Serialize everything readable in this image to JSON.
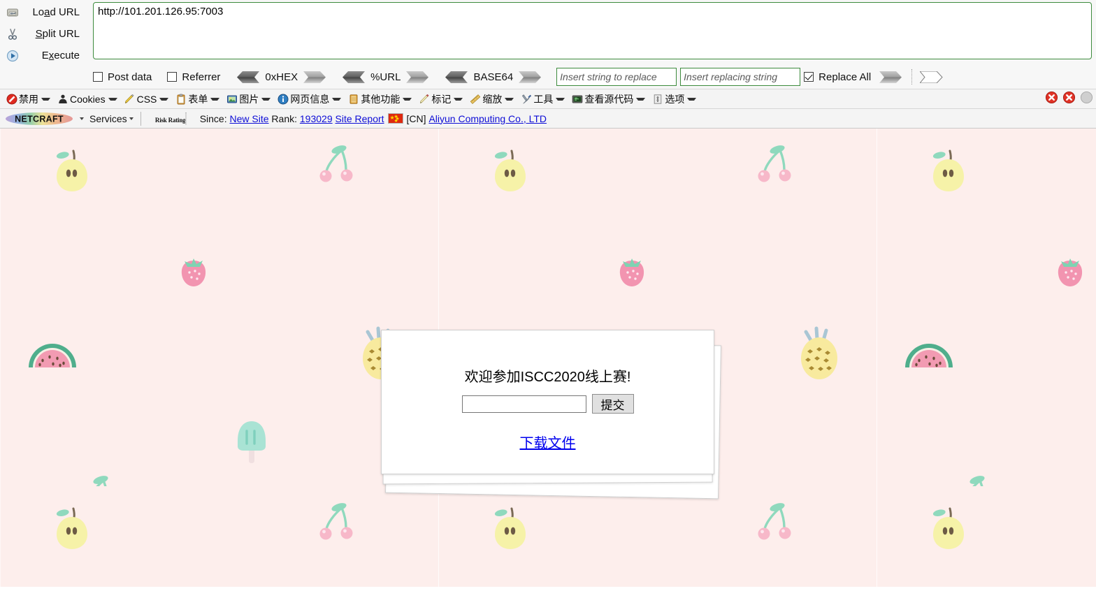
{
  "hackbar": {
    "actions": [
      {
        "icon": "load-url-icon",
        "label": "Load URL",
        "accesskey": "a"
      },
      {
        "icon": "split-url-icon",
        "label": "Split URL",
        "accesskey": "S"
      },
      {
        "icon": "execute-icon",
        "label": "Execute",
        "accesskey": "x"
      }
    ],
    "url_value": "http://101.201.126.95:7003",
    "url_placeholder": "",
    "checkboxes": [
      {
        "name": "post-data",
        "label": "Post data",
        "checked": false
      },
      {
        "name": "referrer",
        "label": "Referrer",
        "checked": false
      }
    ],
    "encoders": [
      {
        "name": "hex",
        "label": "0xHEX"
      },
      {
        "name": "url",
        "label": "%URL"
      },
      {
        "name": "base64",
        "label": "BASE64"
      }
    ],
    "replace": {
      "search_placeholder": "Insert string to replace",
      "search_value": "",
      "replace_placeholder": "Insert replacing string",
      "replace_value": "",
      "replace_all_label": "Replace All",
      "replace_all_checked": true
    }
  },
  "webdev_toolbar": {
    "items": [
      {
        "icon": "disable-icon",
        "label": "禁用"
      },
      {
        "icon": "cookies-icon",
        "label": "Cookies"
      },
      {
        "icon": "css-icon",
        "label": "CSS"
      },
      {
        "icon": "forms-icon",
        "label": "表单"
      },
      {
        "icon": "images-icon",
        "label": "图片"
      },
      {
        "icon": "page-info-icon",
        "label": "网页信息"
      },
      {
        "icon": "misc-icon",
        "label": "其他功能"
      },
      {
        "icon": "outline-icon",
        "label": "标记"
      },
      {
        "icon": "resize-icon",
        "label": "缩放"
      },
      {
        "icon": "tools-icon",
        "label": "工具"
      },
      {
        "icon": "view-source-icon",
        "label": "查看源代码"
      },
      {
        "icon": "options-icon",
        "label": "选项"
      }
    ],
    "right_icons": [
      {
        "icon": "error-badge-icon",
        "color": "#e03226"
      },
      {
        "icon": "error-badge-icon",
        "color": "#e03226"
      },
      {
        "icon": "partial-badge-icon",
        "color": "#b8b8b8"
      }
    ]
  },
  "netcraft": {
    "logo_text": "NETCRAFT",
    "services_label": "Services",
    "risk_rating_label": "Risk Rating",
    "risk_bar_color": "#ef1c1c",
    "since_label": "Since:",
    "since_value": "New Site",
    "rank_label": "Rank:",
    "rank_value": "193029",
    "site_report_label": "Site Report",
    "country_code": "[CN]",
    "country_flag": "cn-flag-icon",
    "host_org": "Aliyun Computing Co., LTD"
  },
  "page": {
    "background_color": "#fdeeec",
    "card": {
      "title": "欢迎参加ISCC2020线上赛!",
      "input_value": "",
      "input_placeholder": "",
      "submit_label": "提交",
      "download_label": "下载文件"
    }
  }
}
